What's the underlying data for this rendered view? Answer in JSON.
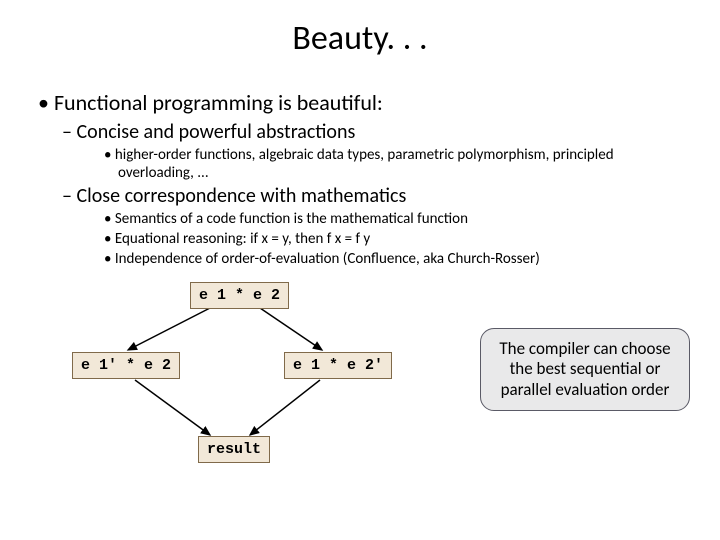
{
  "title": "Beauty. . .",
  "bullets": {
    "l1": "Functional programming is beautiful:",
    "l2a": "Concise and powerful abstractions",
    "l3a": "higher-order functions, algebraic data types, parametric polymorphism, principled overloading, ...",
    "l2b": "Close correspondence with mathematics",
    "l3b": "Semantics of a code function is the mathematical function",
    "l3c": "Equational reasoning: if x = y, then f x = f y",
    "l3d": "Independence of order-of-evaluation (Confluence, aka Church-Rosser)"
  },
  "diagram": {
    "top": "e 1 * e 2",
    "left": "e 1' * e 2",
    "right": "e 1 * e 2'",
    "bottom": "result"
  },
  "callout": "The compiler can choose the best sequential or parallel evaluation order"
}
